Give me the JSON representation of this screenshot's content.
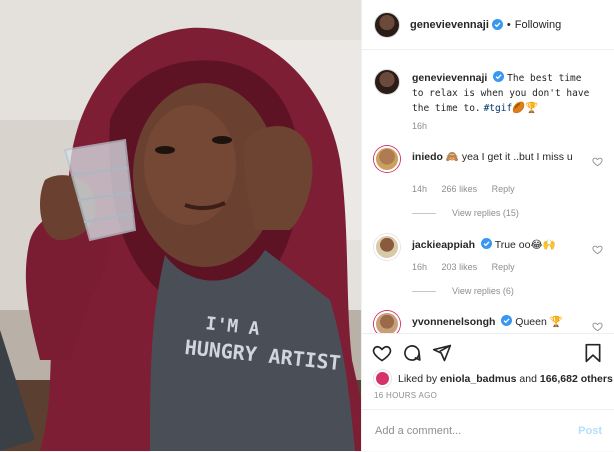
{
  "post": {
    "author": "genevievennaji",
    "follow_status": "Following",
    "separator": "•",
    "caption": {
      "username": "genevievennaji",
      "text": "The best time to relax is when you don't have the time to.",
      "hashtag": "#tgif",
      "emoji": "🏉🏆",
      "time": "16h"
    },
    "image_text": {
      "line1": "I'M A",
      "line2": "HUNGRY ARTIST"
    }
  },
  "comments": [
    {
      "username": "iniedo",
      "verified": false,
      "text": "🙈 yea I get it ..but I miss u",
      "time": "14h",
      "likes": "266 likes",
      "reply_label": "Reply",
      "view_replies": "View replies (15)",
      "avatar_color": "#c9a25e"
    },
    {
      "username": "jackieappiah",
      "verified": true,
      "text": "True oo😂🙌",
      "time": "16h",
      "likes": "203 likes",
      "reply_label": "Reply",
      "view_replies": "View replies (6)",
      "avatar_color": "#d8c9a8"
    },
    {
      "username": "yvonnenelsongh",
      "verified": true,
      "text": "Queen 🏆",
      "avatar_color": "#c7a07a"
    }
  ],
  "footer": {
    "liked_by_prefix": "Liked by",
    "liked_by_user": "eniola_badmus",
    "liked_by_and": "and",
    "liked_by_count": "166,682 others",
    "time_ago": "16 HOURS AGO",
    "comment_placeholder": "Add a comment...",
    "post_label": "Post"
  },
  "icons": {
    "like": "heart-icon",
    "comment": "comment-icon",
    "share": "share-icon",
    "save": "bookmark-icon",
    "verified": "verified-badge-icon"
  },
  "colors": {
    "verified": "#3897f0",
    "link": "#00376b",
    "muted": "#8e8e8e",
    "post_disabled": "#b2dffc"
  }
}
